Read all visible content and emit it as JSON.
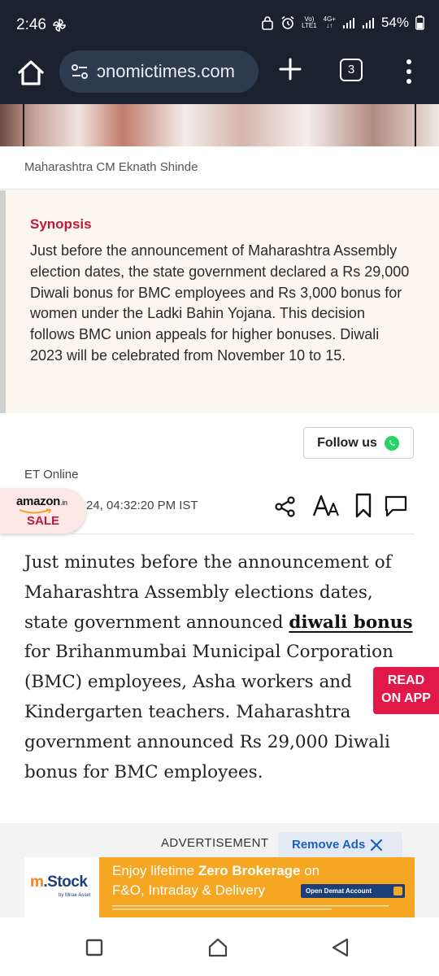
{
  "status_bar": {
    "time": "2:46",
    "network_top": "Vo)",
    "network_bottom": "LTE1",
    "data_top": "4G+",
    "data_bottom": "↓↑",
    "battery": "54%",
    "icons": [
      "pinwheel-icon",
      "alarm-icon",
      "signal-icon",
      "battery-icon"
    ]
  },
  "browser": {
    "url": "ɔnomictimes.com",
    "tab_count": "3",
    "icons": [
      "home-icon",
      "site-settings-icon",
      "plus-icon",
      "tabs-icon",
      "more-vert-icon"
    ]
  },
  "article": {
    "image_caption": "Maharashtra CM Eknath Shinde",
    "synopsis_title": "Synopsis",
    "synopsis_text": "Just before the announcement of Maharashtra Assembly election dates, the state government declared a Rs 29,000 Diwali bonus for BMC employees and Rs 3,000 bonus for women under the Ladki Bahin Yojana. This decision follows BMC union appeals for higher bonuses. Diwali 2023 will be celebrated from November 10 to 15.",
    "follow_label": "Follow us",
    "author": "ET Online",
    "timestamp": "24, 04:32:20 PM IST",
    "body_before": "Just minutes before the announcement of Maharashtra Assembly elections dates, state government announced ",
    "body_link": "diwali bonus",
    "body_after": " for Brihanmumbai Municipal Corporation (BMC) employees, Asha workers and Kindergarten teachers. Maharashtra government announced Rs 29,000 Diwali bonus for BMC employees."
  },
  "amazon_badge": {
    "logo": "amazon",
    "logo_suffix": ".in",
    "sale": "SALE"
  },
  "read_on_app": {
    "line1": "READ",
    "line2": "ON APP"
  },
  "ad": {
    "label": "ADVERTISEMENT",
    "remove_label": "Remove Ads",
    "brand_m": "m",
    "brand_rest": ".Stock",
    "brand_sub": "by Mirae Asset",
    "line1_prefix": "Enjoy lifetime ",
    "line1_bold": "Zero Brokerage",
    "line1_suffix": " on",
    "line2": "F&O, Intraday & Delivery",
    "cta": "Open Demat Account",
    "colors": {
      "banner": "#f5a623",
      "brand": "#1c3f7a"
    }
  },
  "nav_bar": {
    "icons": [
      "recent-apps-icon",
      "home-icon",
      "back-icon"
    ]
  },
  "colors": {
    "browser_bg": "#1a2230",
    "accent_red": "#c2183c",
    "read_on_app_bg": "#e0194a",
    "synopsis_bg": "#fbf7ef",
    "link_blue": "#1d5fbf"
  }
}
